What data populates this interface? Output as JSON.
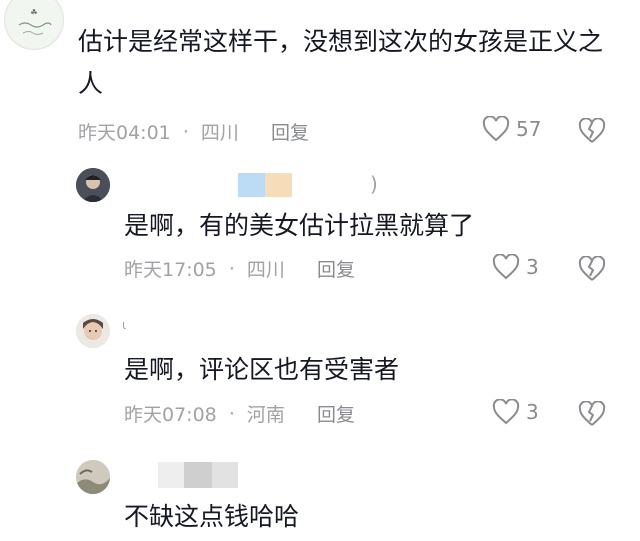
{
  "comments": [
    {
      "text_line1": "估计是经常这样干，没想到这次的女孩是正义之",
      "text_line2": "人",
      "time": "昨天04:01",
      "separator": "·",
      "location": "四川",
      "reply_label": "回复",
      "likes": "57"
    },
    {
      "username_suffix": ")",
      "text": "是啊，有的美女估计拉黑就算了",
      "time": "昨天17:05",
      "separator": "·",
      "location": "四川",
      "reply_label": "回复",
      "likes": "3"
    },
    {
      "username_suffix": "ι",
      "text": "是啊，评论区也有受害者",
      "time": "昨天07:08",
      "separator": "·",
      "location": "河南",
      "reply_label": "回复",
      "likes": "3"
    },
    {
      "text": "不缺这点钱哈哈"
    }
  ],
  "colors": {
    "text": "#161823",
    "meta": "#a1a2a7",
    "icon": "#8a8b91",
    "blur_blue": "#bcdcf6",
    "blur_orange": "#f6dcb8",
    "blur_gray": "#d4d4d4"
  }
}
